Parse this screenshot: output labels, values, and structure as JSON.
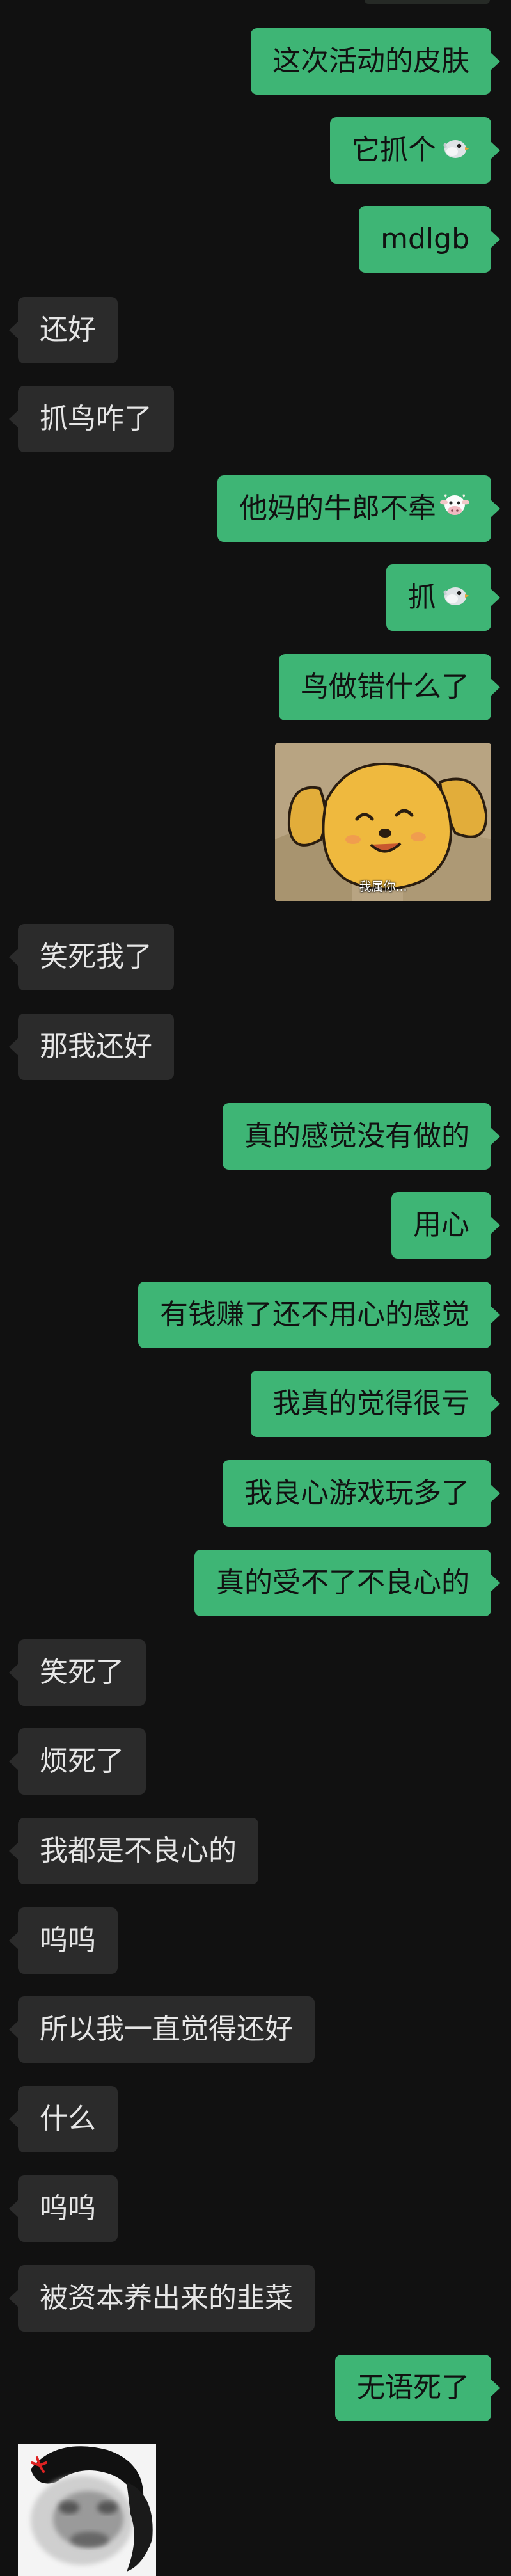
{
  "colors": {
    "background": "#111111",
    "outgoing_bubble": "#3eb575",
    "incoming_bubble": "#2b2b2b",
    "incoming_text": "#e6e6e6",
    "outgoing_text": "#111111"
  },
  "messages": [
    {
      "side": "out",
      "text": "这次活动的皮肤"
    },
    {
      "side": "out",
      "text": "它抓个",
      "emoji": "bird-emoji"
    },
    {
      "side": "out",
      "text": "mdlgb"
    },
    {
      "side": "in",
      "text": "还好"
    },
    {
      "side": "in",
      "text": "抓鸟咋了"
    },
    {
      "side": "out",
      "text": "他妈的牛郎不牵",
      "emoji": "cow-emoji"
    },
    {
      "side": "out",
      "text": "抓",
      "emoji": "bird-emoji"
    },
    {
      "side": "out",
      "text": "鸟做错什么了"
    },
    {
      "side": "out",
      "sticker": "dog-sticker",
      "caption": "我属你..."
    },
    {
      "side": "in",
      "text": "笑死我了"
    },
    {
      "side": "in",
      "text": "那我还好"
    },
    {
      "side": "out",
      "text": "真的感觉没有做的"
    },
    {
      "side": "out",
      "text": "用心"
    },
    {
      "side": "out",
      "text": "有钱赚了还不用心的感觉"
    },
    {
      "side": "out",
      "text": "我真的觉得很亏"
    },
    {
      "side": "out",
      "text": "我良心游戏玩多了"
    },
    {
      "side": "out",
      "text": "真的受不了不良心的"
    },
    {
      "side": "in",
      "text": "笑死了"
    },
    {
      "side": "in",
      "text": "烦死了"
    },
    {
      "side": "in",
      "text": "我都是不良心的"
    },
    {
      "side": "in",
      "text": "呜呜"
    },
    {
      "side": "in",
      "text": "所以我一直觉得还好"
    },
    {
      "side": "in",
      "text": "什么"
    },
    {
      "side": "in",
      "text": "呜呜"
    },
    {
      "side": "in",
      "text": "被资本养出来的韭菜"
    },
    {
      "side": "out",
      "text": "无语死了"
    },
    {
      "side": "in",
      "sticker": "meme-face-sticker"
    }
  ]
}
